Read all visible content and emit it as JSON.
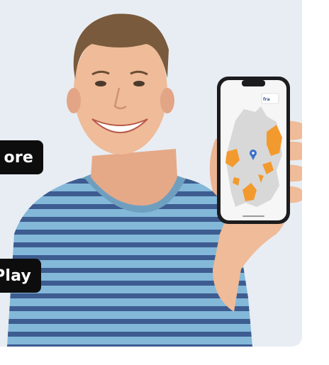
{
  "badges": {
    "app_store_label": "ore",
    "google_play_label": "Play"
  },
  "phone_app": {
    "logo_text": "fra"
  },
  "colors": {
    "background": "#e8edf3",
    "badge": "#0d0d0d",
    "map_highlight": "#f29a2e",
    "shirt_light": "#7fb4d6",
    "shirt_dark": "#3c5b8f"
  },
  "icons": [
    "person-photo",
    "smartphone",
    "germany-map",
    "app-logo-icon",
    "location-pin-icon"
  ]
}
